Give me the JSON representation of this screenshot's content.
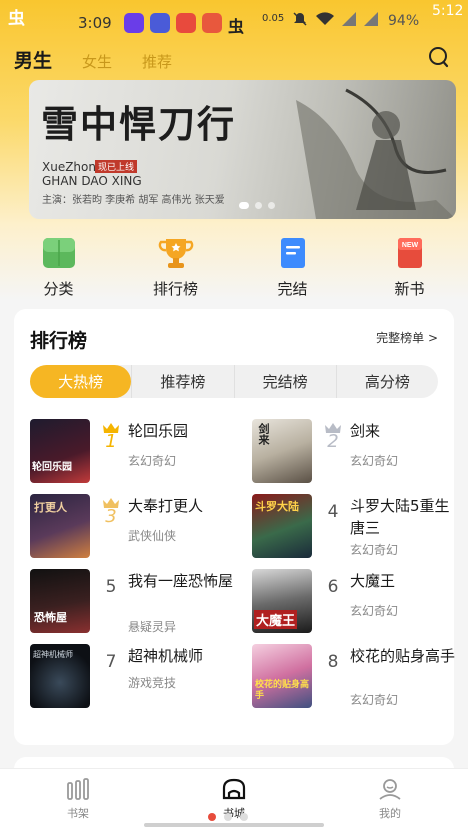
{
  "status_bar": {
    "app_glyph": "虫",
    "time": "3:09",
    "net_speed": "0.05",
    "battery": "94%",
    "clock": "5:12"
  },
  "header": {
    "tabs": [
      {
        "label": "男生",
        "active": true
      },
      {
        "label": "女生",
        "active": false
      },
      {
        "label": "推荐",
        "active": false
      }
    ]
  },
  "banner": {
    "title_calligraphy": "雪中悍刀行",
    "title_en_1": "XueZhon",
    "title_en_2": "GHAN DAO XING",
    "red_tag": "现已上线",
    "cast": "主演：张若昀 李庚希 胡军 高伟光 张天爱"
  },
  "categories": [
    {
      "label": "分类",
      "icon": "category-icon",
      "color": "#5cb85c"
    },
    {
      "label": "排行榜",
      "icon": "trophy-icon",
      "color": "#f5a623"
    },
    {
      "label": "完结",
      "icon": "book-complete-icon",
      "color": "#3d8bfd"
    },
    {
      "label": "新书",
      "icon": "new-book-icon",
      "color": "#e74c3c"
    }
  ],
  "ranking": {
    "title": "排行榜",
    "more": "完整榜单 >",
    "tabs": [
      {
        "label": "大热榜",
        "active": true
      },
      {
        "label": "推荐榜",
        "active": false
      },
      {
        "label": "完结榜",
        "active": false
      },
      {
        "label": "高分榜",
        "active": false
      }
    ],
    "books": [
      {
        "rank": "1",
        "title": "轮回乐园",
        "genre": "玄幻奇幻",
        "cover_text": "轮回乐园"
      },
      {
        "rank": "2",
        "title": "剑来",
        "genre": "玄幻奇幻",
        "cover_text": "剑来"
      },
      {
        "rank": "3",
        "title": "大奉打更人",
        "genre": "武侠仙侠",
        "cover_text": "打更人"
      },
      {
        "rank": "4",
        "title": "斗罗大陆5重生唐三",
        "genre": "玄幻奇幻",
        "cover_text": "斗罗大陆"
      },
      {
        "rank": "5",
        "title": "我有一座恐怖屋",
        "genre": "悬疑灵异",
        "cover_text": "恐怖屋"
      },
      {
        "rank": "6",
        "title": "大魔王",
        "genre": "玄幻奇幻",
        "cover_text": "大魔王"
      },
      {
        "rank": "7",
        "title": "超神机械师",
        "genre": "游戏竞技",
        "cover_text": "超神机械师"
      },
      {
        "rank": "8",
        "title": "校花的贴身高手",
        "genre": "玄幻奇幻",
        "cover_text": "校花的贴身高手"
      }
    ]
  },
  "bottom_nav": [
    {
      "label": "书架",
      "icon": "bookshelf-icon",
      "active": false
    },
    {
      "label": "书城",
      "icon": "store-home-icon",
      "active": true
    },
    {
      "label": "我的",
      "icon": "profile-icon",
      "active": false
    }
  ],
  "colors": {
    "accent": "#f6b623",
    "header_gradient_top": "#f9c62f",
    "crown_gold": "#f5b400",
    "crown_silver": "#b8bcc6"
  }
}
